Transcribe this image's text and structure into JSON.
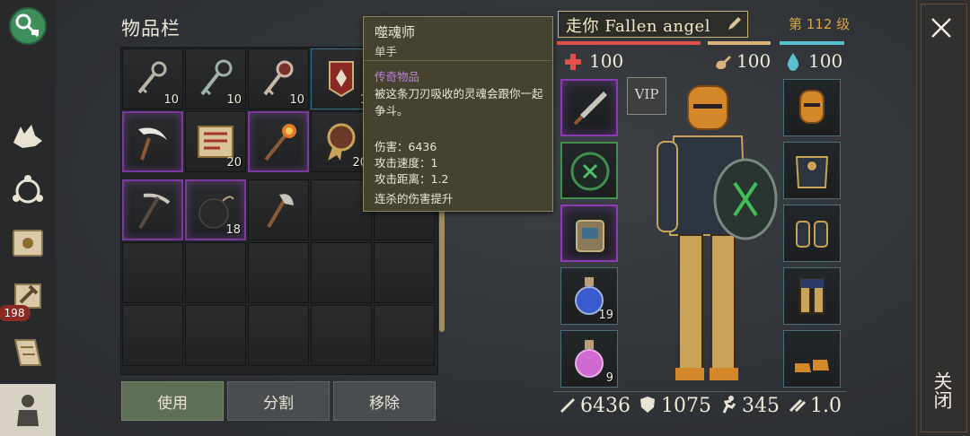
{
  "inventory": {
    "title": "物品栏",
    "items": [
      {
        "name": "key-icon",
        "qty": "10"
      },
      {
        "name": "key-icon",
        "qty": "10"
      },
      {
        "name": "key-icon",
        "qty": "10"
      },
      {
        "name": "banner-icon",
        "qty": "1"
      },
      {
        "name": "scythe-icon",
        "qty": ""
      },
      {
        "name": "scroll-icon",
        "qty": "20"
      },
      {
        "name": "torch-axe-icon",
        "qty": ""
      },
      {
        "name": "medal-icon",
        "qty": "20"
      },
      {
        "name": "pickaxe-icon",
        "qty": ""
      },
      {
        "name": "bomb-icon",
        "qty": "18"
      },
      {
        "name": "axe-icon",
        "qty": ""
      }
    ],
    "buttons": {
      "use": "使用",
      "split": "分割",
      "remove": "移除"
    }
  },
  "tooltip": {
    "title": "噬魂师",
    "hand": "单手",
    "rarity": "传奇物品",
    "description": "被这条刀刃吸收的灵魂会跟你一起争斗。",
    "stats": [
      {
        "label": "伤害：",
        "value": "6436"
      },
      {
        "label": "攻击速度：",
        "value": "1"
      },
      {
        "label": "攻击距离：",
        "value": "1.2"
      }
    ],
    "bonus": "连杀的伤害提升"
  },
  "character": {
    "name": "走你 Fallen angel",
    "level": "第 112 级",
    "health": "100",
    "hunger": "100",
    "water": "100",
    "vip": "VIP",
    "left_slots": [
      {
        "name": "dagger-icon",
        "qty": ""
      },
      {
        "name": "shield-rune-icon",
        "qty": ""
      },
      {
        "name": "backpack-icon",
        "qty": ""
      },
      {
        "name": "blue-potion-icon",
        "qty": "19"
      },
      {
        "name": "pink-potion-icon",
        "qty": "9"
      }
    ],
    "right_slots": [
      {
        "name": "helmet-icon"
      },
      {
        "name": "chest-armor-icon"
      },
      {
        "name": "gloves-icon"
      },
      {
        "name": "leg-armor-icon"
      },
      {
        "name": "boots-icon"
      }
    ],
    "bottom_stats": {
      "damage": "6436",
      "armor": "1075",
      "speed": "345",
      "attack_speed": "1.0"
    }
  },
  "sidebar": {
    "badge": "198"
  },
  "close": {
    "label": "关闭"
  },
  "colors": {
    "health": "#e0504a",
    "hunger": "#d8b27a",
    "water": "#5bbfd0",
    "legendary": "#c27fe6",
    "level": "#d9a545"
  }
}
